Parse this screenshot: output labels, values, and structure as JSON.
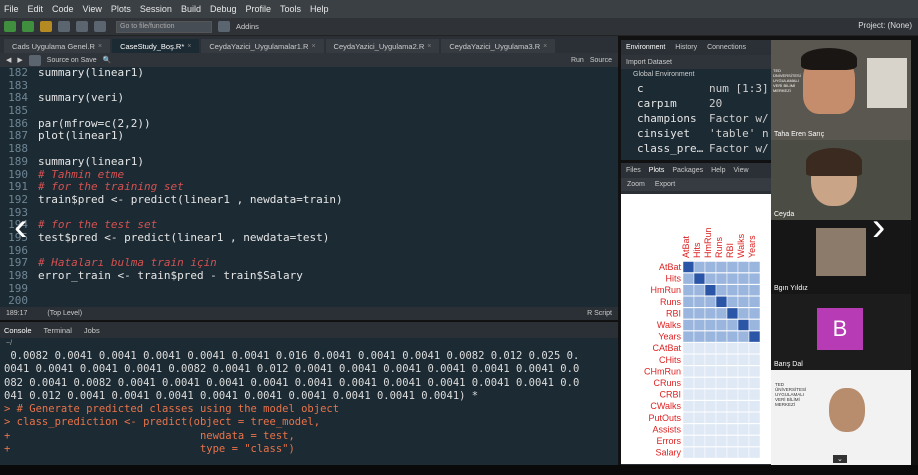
{
  "menu": [
    "File",
    "Edit",
    "Code",
    "View",
    "Plots",
    "Session",
    "Build",
    "Debug",
    "Profile",
    "Tools",
    "Help"
  ],
  "toolbar": {
    "goto_placeholder": "Go to file/function",
    "addins": "Addins",
    "project": "Project: (None)"
  },
  "editor": {
    "tabs": [
      "Cads Uygulama Genel.R",
      "CaseStudy_Boş.R*",
      "CeydaYazici_Uygulamalar1.R",
      "CeydaYazici_Uygulama2.R",
      "CeydaYazici_Uygulama3.R"
    ],
    "source_on_save": "Source on Save",
    "run": "Run",
    "source": "Source",
    "status_pos": "189:17",
    "status_scope": "(Top Level)",
    "status_type": "R Script",
    "lines": [
      {
        "n": "182",
        "t": "summary(linear1)"
      },
      {
        "n": "183",
        "t": ""
      },
      {
        "n": "184",
        "t": "summary(veri)"
      },
      {
        "n": "185",
        "t": ""
      },
      {
        "n": "186",
        "t": "par(mfrow=c(2,2))"
      },
      {
        "n": "187",
        "t": "plot(linear1)"
      },
      {
        "n": "188",
        "t": ""
      },
      {
        "n": "189",
        "t": "summary(linear1)"
      },
      {
        "n": "190",
        "t": "# Tahmin etme",
        "c": true
      },
      {
        "n": "191",
        "t": "# for the training set",
        "c": true
      },
      {
        "n": "192",
        "t": "train$pred <- predict(linear1 , newdata=train)"
      },
      {
        "n": "193",
        "t": ""
      },
      {
        "n": "194",
        "t": "# for the test set",
        "c": true
      },
      {
        "n": "195",
        "t": "test$pred <- predict(linear1 , newdata=test)"
      },
      {
        "n": "196",
        "t": ""
      },
      {
        "n": "197",
        "t": "# Hataları bulma train için",
        "c": true
      },
      {
        "n": "198",
        "t": "error_train <- train$pred - train$Salary"
      },
      {
        "n": "199",
        "t": ""
      },
      {
        "n": "200",
        "t": ""
      }
    ]
  },
  "console": {
    "tabs": [
      "Console",
      "Terminal",
      "Jobs"
    ],
    "path": "~/",
    "lines": [
      {
        "t": " 0.0082 0.0041 0.0041 0.0041 0.0041 0.0041 0.016 0.0041 0.0041 0.0041 0.0082 0.012 0.025 0."
      },
      {
        "t": "0041 0.0041 0.0041 0.0041 0.0082 0.0041 0.012 0.0041 0.0041 0.0041 0.0041 0.0041 0.0041 0.0"
      },
      {
        "t": "082 0.0041 0.0082 0.0041 0.0041 0.0041 0.0041 0.0041 0.0041 0.0041 0.0041 0.0041 0.0041 0.0"
      },
      {
        "t": "041 0.012 0.0041 0.0041 0.0041 0.0041 0.0041 0.0041 0.0041 0.0041 0.0041) *"
      },
      {
        "t": "> # Generate predicted classes using the model object",
        "p": true
      },
      {
        "t": "> class_prediction <- predict(object = tree_model,",
        "p": true
      },
      {
        "t": "+                              newdata = test,",
        "p": true
      },
      {
        "t": "+                              type = \"class\")",
        "p": true
      }
    ]
  },
  "environment": {
    "tabs": [
      "Environment",
      "History",
      "Connections"
    ],
    "import": "Import Dataset",
    "scope": "Global Environment",
    "rows": [
      {
        "n": "c",
        "v": "num [1:3]"
      },
      {
        "n": "carpım",
        "v": "20"
      },
      {
        "n": "champions",
        "v": "Factor w/"
      },
      {
        "n": "cinsiyet",
        "v": "'table' n"
      },
      {
        "n": "class_pre…",
        "v": "Factor w/"
      }
    ]
  },
  "files": {
    "tabs": [
      "Files",
      "Plots",
      "Packages",
      "Help",
      "View"
    ],
    "zoom": "Zoom",
    "export": "Export",
    "col_labels": [
      "AtBat",
      "Hits",
      "HmRun",
      "Runs",
      "RBI",
      "Walks",
      "Years"
    ],
    "row_labels": [
      "AtBat",
      "Hits",
      "HmRun",
      "Runs",
      "RBI",
      "Walks",
      "Years",
      "CAtBat",
      "CHits",
      "CHmRun",
      "CRuns",
      "CRBI",
      "CWalks",
      "PutOuts",
      "Assists",
      "Errors",
      "Salary"
    ]
  },
  "video": {
    "participants": [
      {
        "name": "Taha Eren Sarıç",
        "logo": "TED ÜNİVERSİTESİ UYGULAMALI VERİ BİLİMİ MERKEZİ"
      },
      {
        "name": "Ceyda"
      },
      {
        "name": "Bgın Yıldız"
      },
      {
        "name": "Barış Dal",
        "initial": "B"
      },
      {
        "name": "",
        "logo": "TED ÜNİVERSİTESİ UYGULAMALI VERİ BİLİMİ MERKEZİ"
      }
    ]
  },
  "colors": {
    "accent_initial": "#b73bb5",
    "comment": "#d25252",
    "number": "#d9a84b",
    "prompt": "#e8734a"
  }
}
